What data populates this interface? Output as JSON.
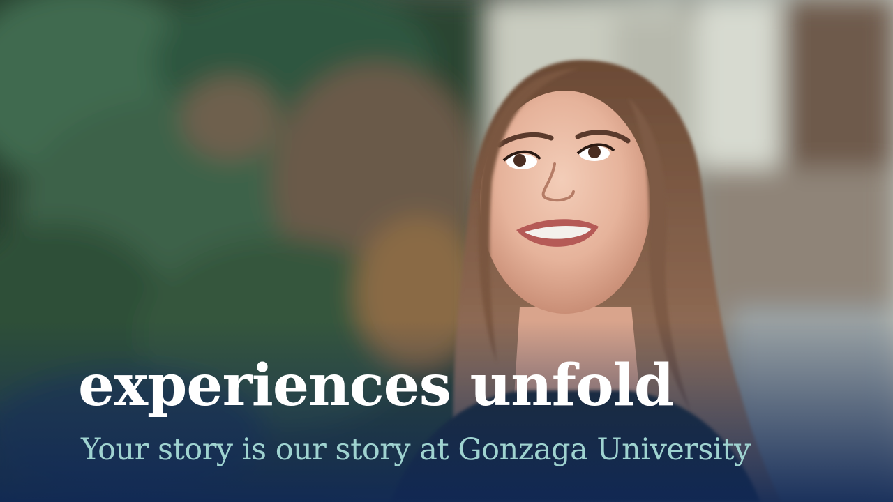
{
  "overlay": {
    "headline": "experiences unfold",
    "subheadline": "Your story is our story at Gonzaga University"
  },
  "colors": {
    "headline": "#ffffff",
    "subheadline": "#9fd3d0",
    "bottom_gradient": "#102856"
  }
}
